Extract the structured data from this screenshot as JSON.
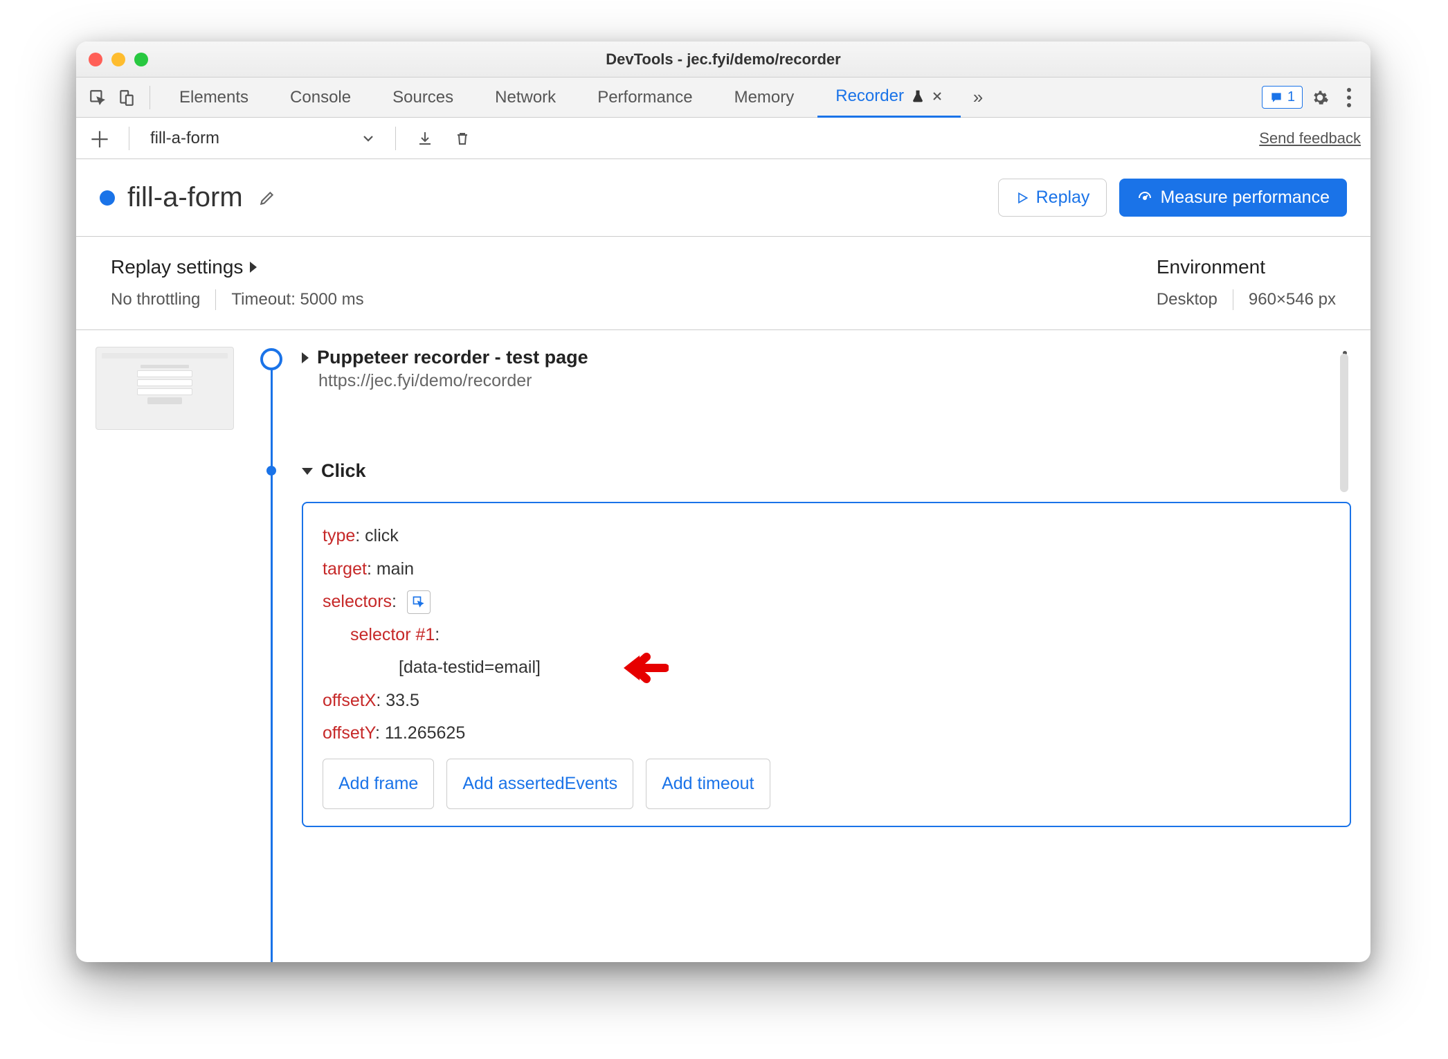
{
  "window": {
    "title": "DevTools - jec.fyi/demo/recorder"
  },
  "tabs": {
    "items": [
      "Elements",
      "Console",
      "Sources",
      "Network",
      "Performance",
      "Memory",
      "Recorder"
    ],
    "active": "Recorder",
    "badge_count": "1"
  },
  "toolbar": {
    "recording_name": "fill-a-form",
    "feedback": "Send feedback"
  },
  "header": {
    "title": "fill-a-form",
    "replay": "Replay",
    "measure": "Measure performance"
  },
  "settings": {
    "replay_label": "Replay settings",
    "throttling": "No throttling",
    "timeout": "Timeout: 5000 ms",
    "env_label": "Environment",
    "device": "Desktop",
    "viewport": "960×546 px"
  },
  "steps": [
    {
      "title": "Puppeteer recorder - test page",
      "url": "https://jec.fyi/demo/recorder"
    },
    {
      "title": "Click",
      "props": {
        "type_key": "type",
        "type_val": "click",
        "target_key": "target",
        "target_val": "main",
        "selectors_key": "selectors",
        "selector1_key": "selector #1",
        "selector1_val": "[data-testid=email]",
        "offsetX_key": "offsetX",
        "offsetX_val": "33.5",
        "offsetY_key": "offsetY",
        "offsetY_val": "11.265625"
      },
      "add": {
        "frame": "Add frame",
        "asserted": "Add assertedEvents",
        "timeout": "Add timeout"
      }
    }
  ]
}
